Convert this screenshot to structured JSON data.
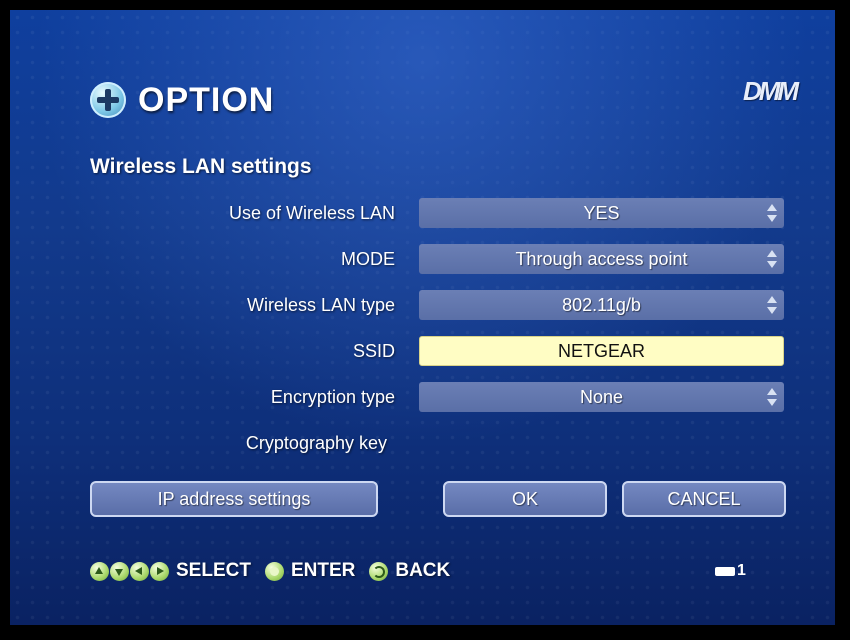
{
  "header": {
    "title": "OPTION",
    "brand": "DMM"
  },
  "section_title": "Wireless LAN settings",
  "settings": [
    {
      "label": "Use of Wireless LAN",
      "value": "YES",
      "type": "select"
    },
    {
      "label": "MODE",
      "value": "Through access point",
      "type": "select"
    },
    {
      "label": "Wireless LAN type",
      "value": "802.11g/b",
      "type": "select"
    },
    {
      "label": "SSID",
      "value": "NETGEAR",
      "type": "text",
      "focused": true
    },
    {
      "label": "Encryption type",
      "value": "None",
      "type": "select"
    },
    {
      "label": "Cryptography key",
      "value": "",
      "type": "text"
    }
  ],
  "buttons": {
    "ip_settings": "IP address settings",
    "ok": "OK",
    "cancel": "CANCEL"
  },
  "nav": {
    "select": "SELECT",
    "enter": "ENTER",
    "back": "BACK"
  },
  "status": {
    "disk_count": "1"
  },
  "colors": {
    "background": "#123a8c",
    "field": "#6275ad",
    "field_focused": "#fffdc4",
    "nav_icon": "#a9d86a"
  }
}
